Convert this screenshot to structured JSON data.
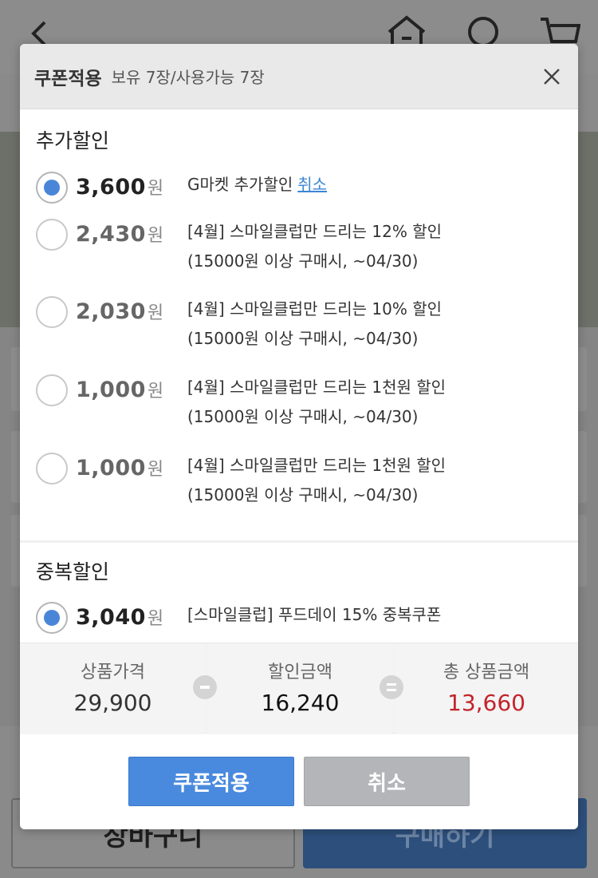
{
  "modal": {
    "title": "쿠폰적용",
    "subtitle": "보유 7장/사용가능 7장"
  },
  "extra_discount": {
    "title": "추가할인",
    "won": "원",
    "coupons": [
      {
        "amount": "3,600",
        "line1": "G마켓 추가할인",
        "line2": "",
        "selected": true,
        "link": "취소"
      },
      {
        "amount": "2,430",
        "line1": "[4월] 스마일클럽만 드리는 12% 할인",
        "line2": "(15000원 이상 구매시, ~04/30)",
        "selected": false
      },
      {
        "amount": "2,030",
        "line1": "[4월] 스마일클럽만 드리는 10% 할인",
        "line2": "(15000원 이상 구매시, ~04/30)",
        "selected": false
      },
      {
        "amount": "1,000",
        "line1": "[4월] 스마일클럽만 드리는 1천원 할인",
        "line2": "(15000원 이상 구매시, ~04/30)",
        "selected": false
      },
      {
        "amount": "1,000",
        "line1": "[4월] 스마일클럽만 드리는 1천원 할인",
        "line2": "(15000원 이상 구매시, ~04/30)",
        "selected": false
      }
    ]
  },
  "duplicate_discount": {
    "title": "중복할인",
    "coupons": [
      {
        "amount": "3,040",
        "line1": "[스마일클럽] 푸드데이 15% 중복쿠폰",
        "selected": true
      }
    ]
  },
  "summary": {
    "product_price_label": "상품가격",
    "product_price": "29,900",
    "discount_label": "할인금액",
    "discount": "16,240",
    "total_label": "총 상품금액",
    "total": "13,660"
  },
  "buttons": {
    "apply": "쿠폰적용",
    "cancel": "취소"
  },
  "background": {
    "cart_button": "장바구니",
    "buy_button": "구매하기"
  },
  "colors": {
    "accent": "#4a86d8",
    "total_red": "#c2242b",
    "link_blue": "#3b86d4"
  }
}
